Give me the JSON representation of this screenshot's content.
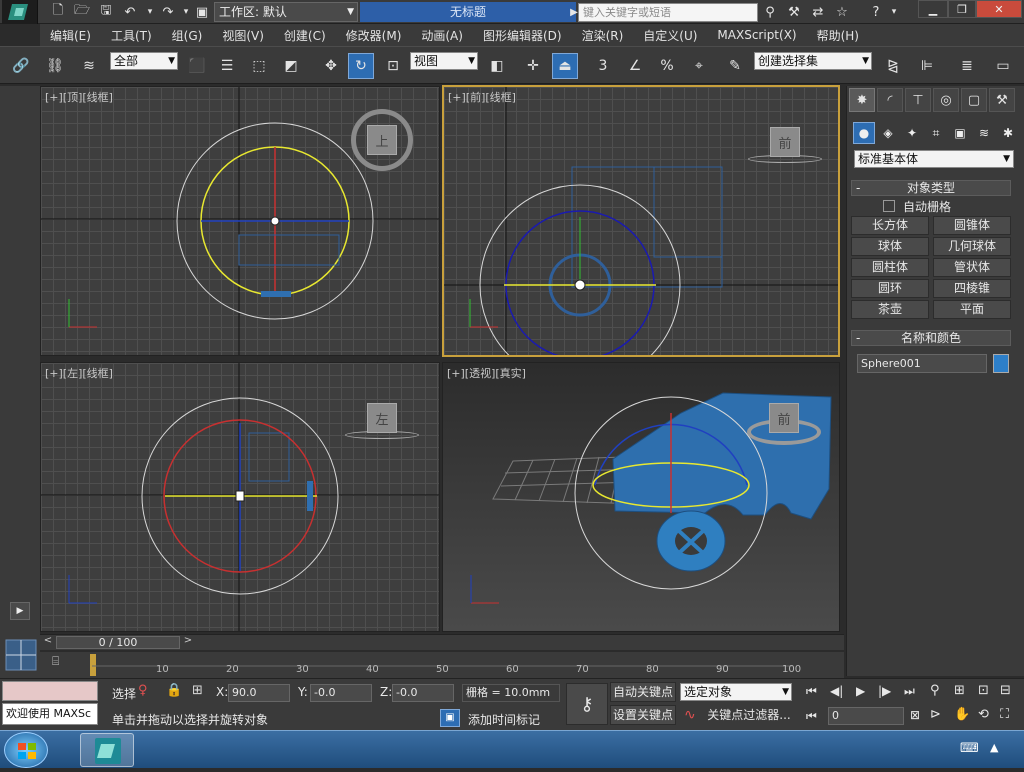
{
  "titlebar": {
    "workspace_label": "工作区: 默认",
    "document_title": "无标题",
    "search_placeholder": "键入关键字或短语"
  },
  "menu": [
    "编辑(E)",
    "工具(T)",
    "组(G)",
    "视图(V)",
    "创建(C)",
    "修改器(M)",
    "动画(A)",
    "图形编辑器(D)",
    "渲染(R)",
    "自定义(U)",
    "MAXScript(X)",
    "帮助(H)"
  ],
  "toolbar": {
    "filter": "全部",
    "ref_coord": "视图",
    "snap_num": "3",
    "angle_snap": "%",
    "named_selection": "创建选择集"
  },
  "viewports": {
    "top": {
      "label": "[+][顶][线框]",
      "cube": "上"
    },
    "front": {
      "label": "[+][前][线框]",
      "cube": "前"
    },
    "left": {
      "label": "[+][左][线框]",
      "cube": "左"
    },
    "persp": {
      "label": "[+][透视][真实]",
      "cube": "前"
    }
  },
  "command_panel": {
    "category": "标准基本体",
    "object_type_title": "对象类型",
    "autogrid": "自动栅格",
    "buttons": [
      "长方体",
      "圆锥体",
      "球体",
      "几何球体",
      "圆柱体",
      "管状体",
      "圆环",
      "四棱锥",
      "茶壶",
      "平面"
    ],
    "name_color_title": "名称和颜色",
    "object_name": "Sphere001",
    "object_color": "#2d7fc9"
  },
  "timeline": {
    "frame_display": "0 / 100",
    "ticks": [
      "10",
      "20",
      "30",
      "40",
      "50",
      "60",
      "70",
      "80",
      "90",
      "100"
    ]
  },
  "status": {
    "prompt_text": "欢迎使用 MAXSc",
    "status_line": "单击并拖动以选择并旋转对象",
    "sel_label": "选择",
    "x_label": "X:",
    "x_value": "90.0",
    "y_label": "Y:",
    "y_value": "-0.0",
    "z_label": "Z:",
    "z_value": "-0.0",
    "grid_text": "栅格 = 10.0mm",
    "add_time_tag": "添加时间标记",
    "auto_key": "自动关键点",
    "set_key": "设置关键点",
    "key_mode": "选定对象",
    "key_filters": "关键点过滤器...",
    "frame_field": "0"
  },
  "colors": {
    "accent": "#2d7fc9",
    "active_viewport": "#c8a03c"
  }
}
